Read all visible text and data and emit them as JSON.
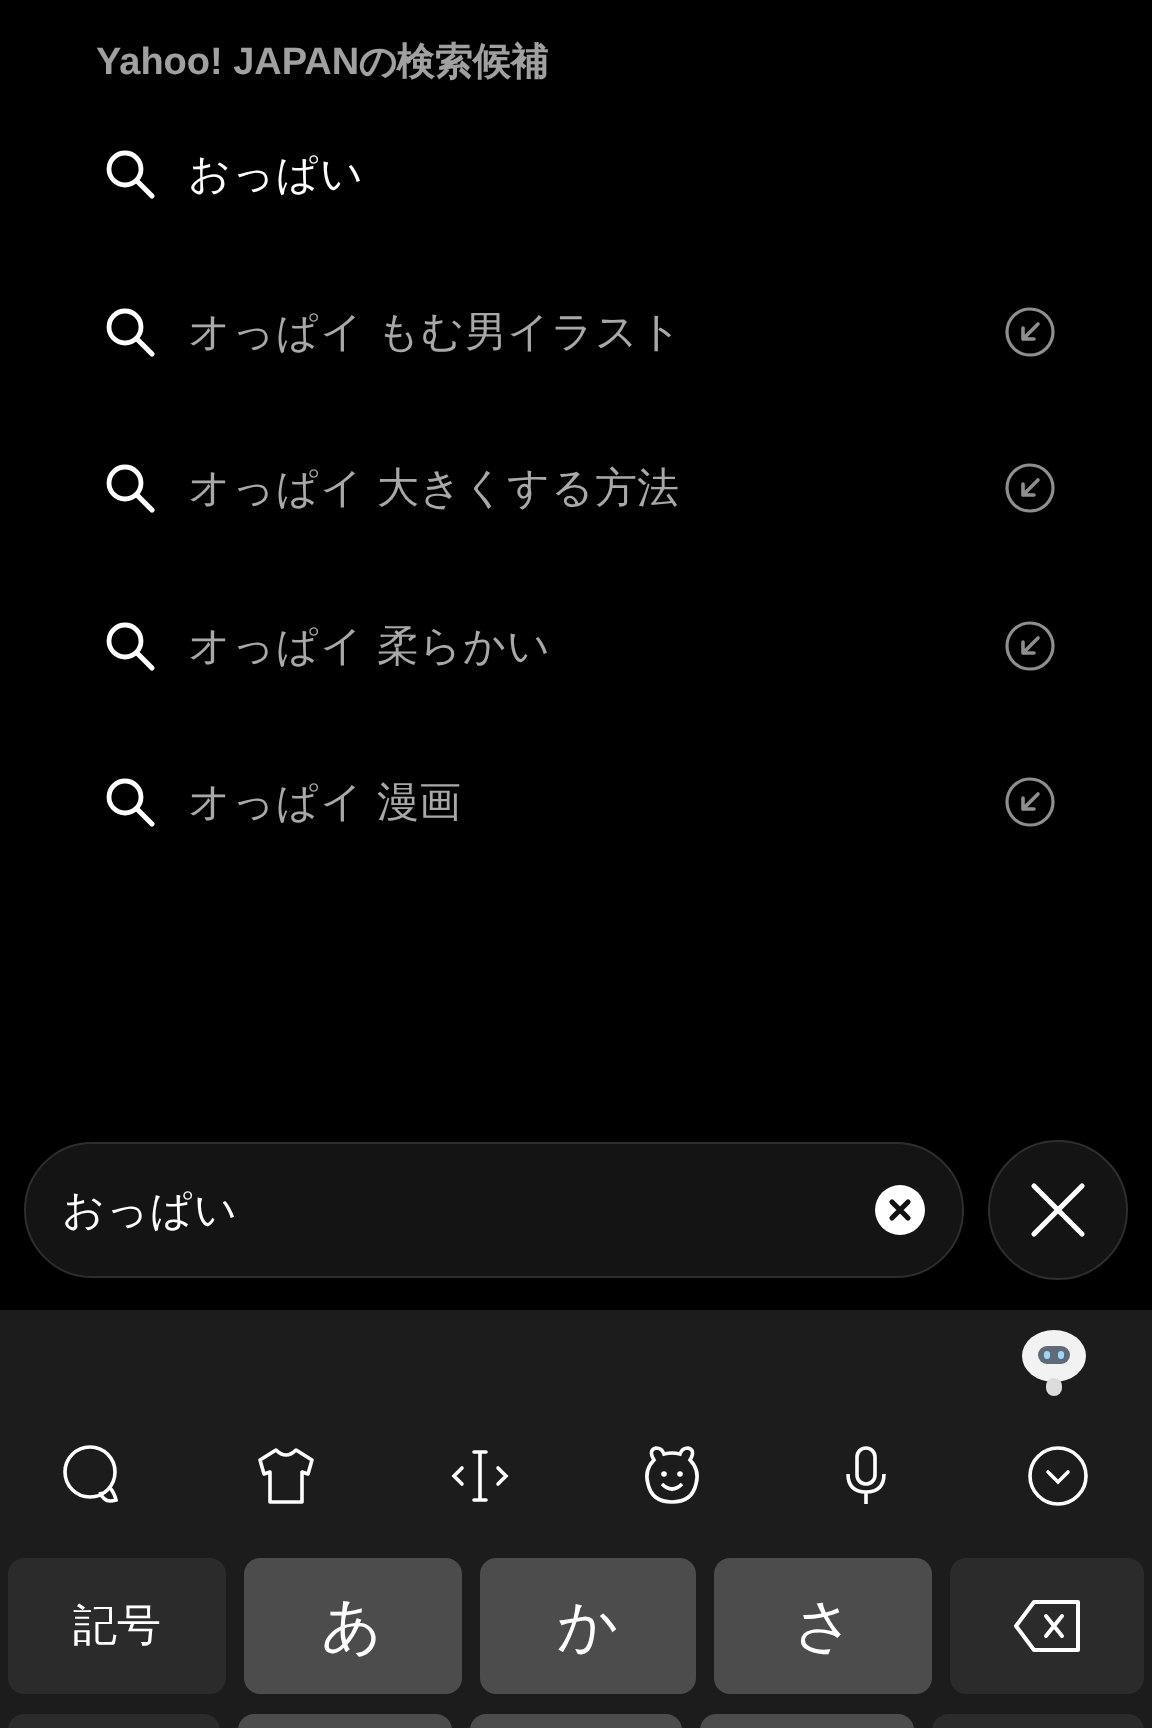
{
  "suggestions_header": "Yahoo! JAPANの検索候補",
  "suggestions": [
    {
      "kind": "query",
      "text": "おっぱい"
    },
    {
      "kind": "completion",
      "text": "オっぱイ もむ男イラスト"
    },
    {
      "kind": "completion",
      "text": "オっぱイ 大きくする方法"
    },
    {
      "kind": "completion",
      "text": "オっぱイ 柔らかい"
    },
    {
      "kind": "completion",
      "text": "オっぱイ 漫画"
    }
  ],
  "search": {
    "value": "おっぱい"
  },
  "keyboard": {
    "keys": [
      {
        "kind": "function",
        "label": "記号"
      },
      {
        "kind": "kana",
        "label": "あ"
      },
      {
        "kind": "kana",
        "label": "か"
      },
      {
        "kind": "kana",
        "label": "さ"
      },
      {
        "kind": "backspace"
      }
    ],
    "next_row": [
      {
        "kind": "function"
      },
      {
        "kind": "kana"
      },
      {
        "kind": "kana"
      },
      {
        "kind": "kana"
      },
      {
        "kind": "function"
      }
    ]
  }
}
